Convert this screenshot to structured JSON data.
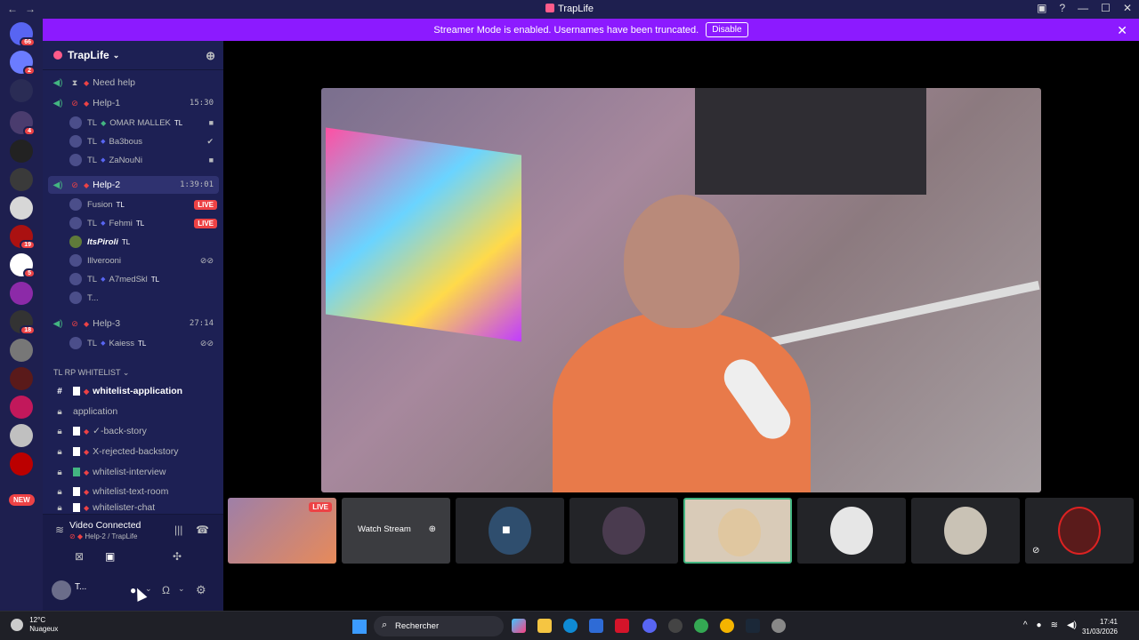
{
  "window": {
    "title": "TrapLife"
  },
  "banner": {
    "text": "Streamer Mode is enabled. Usernames have been truncated.",
    "disable_label": "Disable"
  },
  "rail": {
    "badges": [
      {
        "label": "66"
      },
      {
        "label": "2"
      },
      {
        "label": "4"
      },
      {
        "label": "19"
      },
      {
        "label": "5"
      },
      {
        "label": "18"
      }
    ],
    "new_label": "NEW"
  },
  "server": {
    "name": "TrapLife"
  },
  "channels": {
    "need_help": {
      "label": "Need help"
    },
    "help1": {
      "label": "Help-1",
      "time": "15:30",
      "users": [
        {
          "tl": "TL",
          "name": "OMAR MALLEK",
          "tag": "TL"
        },
        {
          "tl": "TL",
          "name": "Ba3bous",
          "tag": ""
        },
        {
          "tl": "TL",
          "name": "ZaNouNi",
          "tag": ""
        }
      ]
    },
    "help2": {
      "label": "Help-2",
      "time": "1:39:01",
      "users": [
        {
          "tl": "",
          "name": "Fusion",
          "tag": "TL",
          "live": "LIVE"
        },
        {
          "tl": "TL",
          "name": "Fehmi",
          "tag": "TL",
          "live": "LIVE"
        },
        {
          "tl": "",
          "name": "ItsPiroli",
          "tag": "TL"
        },
        {
          "tl": "",
          "name": "Illverooni",
          "tag": ""
        },
        {
          "tl": "TL",
          "name": "A7medSkl",
          "tag": "TL"
        },
        {
          "tl": "",
          "name": "T...",
          "tag": ""
        }
      ]
    },
    "help3": {
      "label": "Help-3",
      "time": "27:14",
      "users": [
        {
          "tl": "TL",
          "name": "Kaiess",
          "tag": "TL"
        }
      ]
    },
    "category": "TL RP WHITELIST",
    "text_channels": [
      {
        "label": "whitelist-application"
      },
      {
        "label": "application"
      },
      {
        "label": "✓-back-story"
      },
      {
        "label": "X-rejected-backstory"
      },
      {
        "label": "whitelist-interview"
      },
      {
        "label": "whitelist-text-room"
      },
      {
        "label": "whitelister-chat"
      }
    ]
  },
  "voice_panel": {
    "status": "Video Connected",
    "location": "Help-2 / TrapLife",
    "username": "T..."
  },
  "stage": {
    "tiles": [
      {
        "live": "LIVE"
      },
      {
        "watch": "Watch Stream"
      }
    ]
  },
  "taskbar": {
    "weather_temp": "12°C",
    "weather_desc": "Nuageux",
    "search": "Rechercher",
    "time": "17:41",
    "date": "31/03/2026"
  }
}
